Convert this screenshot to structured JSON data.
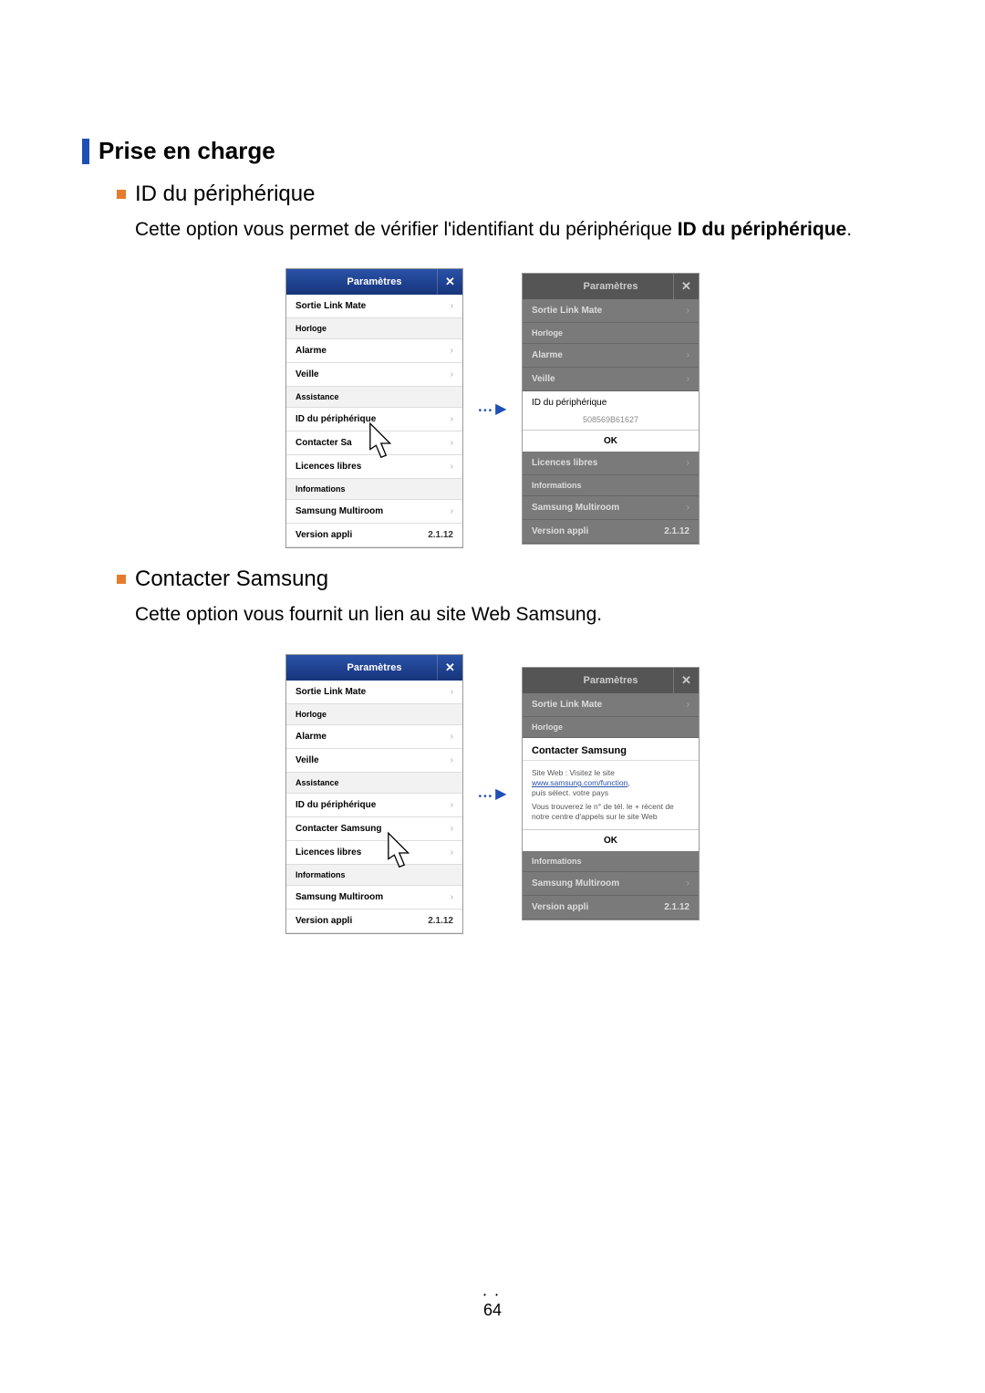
{
  "page_number": "64",
  "h1": "Prise en charge",
  "section1": {
    "title": "ID du périphérique",
    "desc_pre": "Cette option vous permet de vérifier l'identifiant du périphérique ",
    "desc_bold": "ID du périphérique",
    "desc_post": "."
  },
  "section2": {
    "title": "Contacter Samsung",
    "desc": "Cette option vous fournit un lien au site Web Samsung."
  },
  "screen": {
    "header": "Paramètres",
    "items": {
      "sortie": "Sortie Link Mate",
      "horloge": "Horloge",
      "alarme": "Alarme",
      "veille": "Veille",
      "assistance": "Assistance",
      "id": "ID du périphérique",
      "contacterShort": "Contacter Sa",
      "contacter": "Contacter Samsung",
      "licences": "Licences libres",
      "informations": "Informations",
      "multiroom": "Samsung Multiroom",
      "version": "Version appli",
      "versionVal": "2.1.12"
    }
  },
  "popup_id": {
    "title": "ID du périphérique",
    "value": "508569B61627",
    "ok": "OK"
  },
  "popup_contact": {
    "title": "Contacter Samsung",
    "line1a": "Site Web : Visitez le site",
    "line1_link": "www.samsung.com/function",
    "line1b": "puis sélect. votre pays",
    "line2": "Vous trouverez le n° de tél. le + récent de notre centre d'appels sur le site Web",
    "ok": "OK"
  }
}
